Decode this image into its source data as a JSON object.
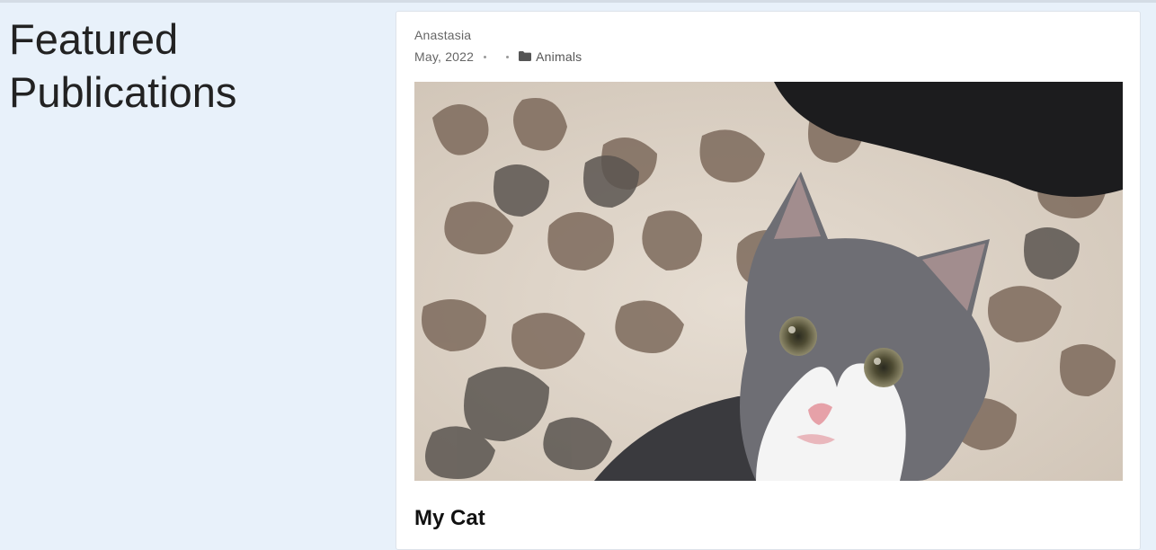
{
  "section": {
    "title_line1": "Featured",
    "title_line2": "Publications"
  },
  "post": {
    "author": "Anastasia",
    "date": "May, 2022",
    "category": "Animals",
    "title": "My Cat",
    "image_alt": "Gray and white kitten on a patterned rug"
  },
  "colors": {
    "page_background": "#e8f1fa",
    "card_background": "#ffffff",
    "meta_text": "#666666",
    "title_text": "#111111"
  },
  "icons": {
    "category": "folder-icon"
  }
}
